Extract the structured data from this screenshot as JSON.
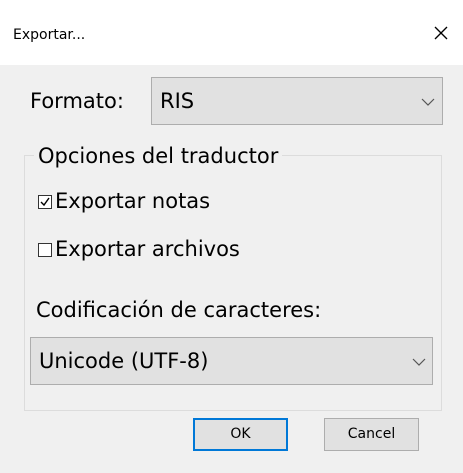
{
  "dialog": {
    "title": "Exportar...",
    "format_label": "Formato:",
    "format_value": "RIS",
    "group_title": "Opciones del traductor",
    "options": [
      {
        "label": "Exportar notas",
        "checked": true
      },
      {
        "label": "Exportar archivos",
        "checked": false
      }
    ],
    "encoding_label": "Codificación de caracteres:",
    "encoding_value": "Unicode (UTF-8)",
    "ok_label": "OK",
    "cancel_label": "Cancel"
  },
  "icons": {
    "close": "close-icon",
    "dropdown": "chevron-down-icon",
    "check": "checkmark-icon"
  },
  "colors": {
    "background": "#f0f0f0",
    "titlebar": "#ffffff",
    "control": "#e1e1e1",
    "focus_border": "#0078d7"
  }
}
